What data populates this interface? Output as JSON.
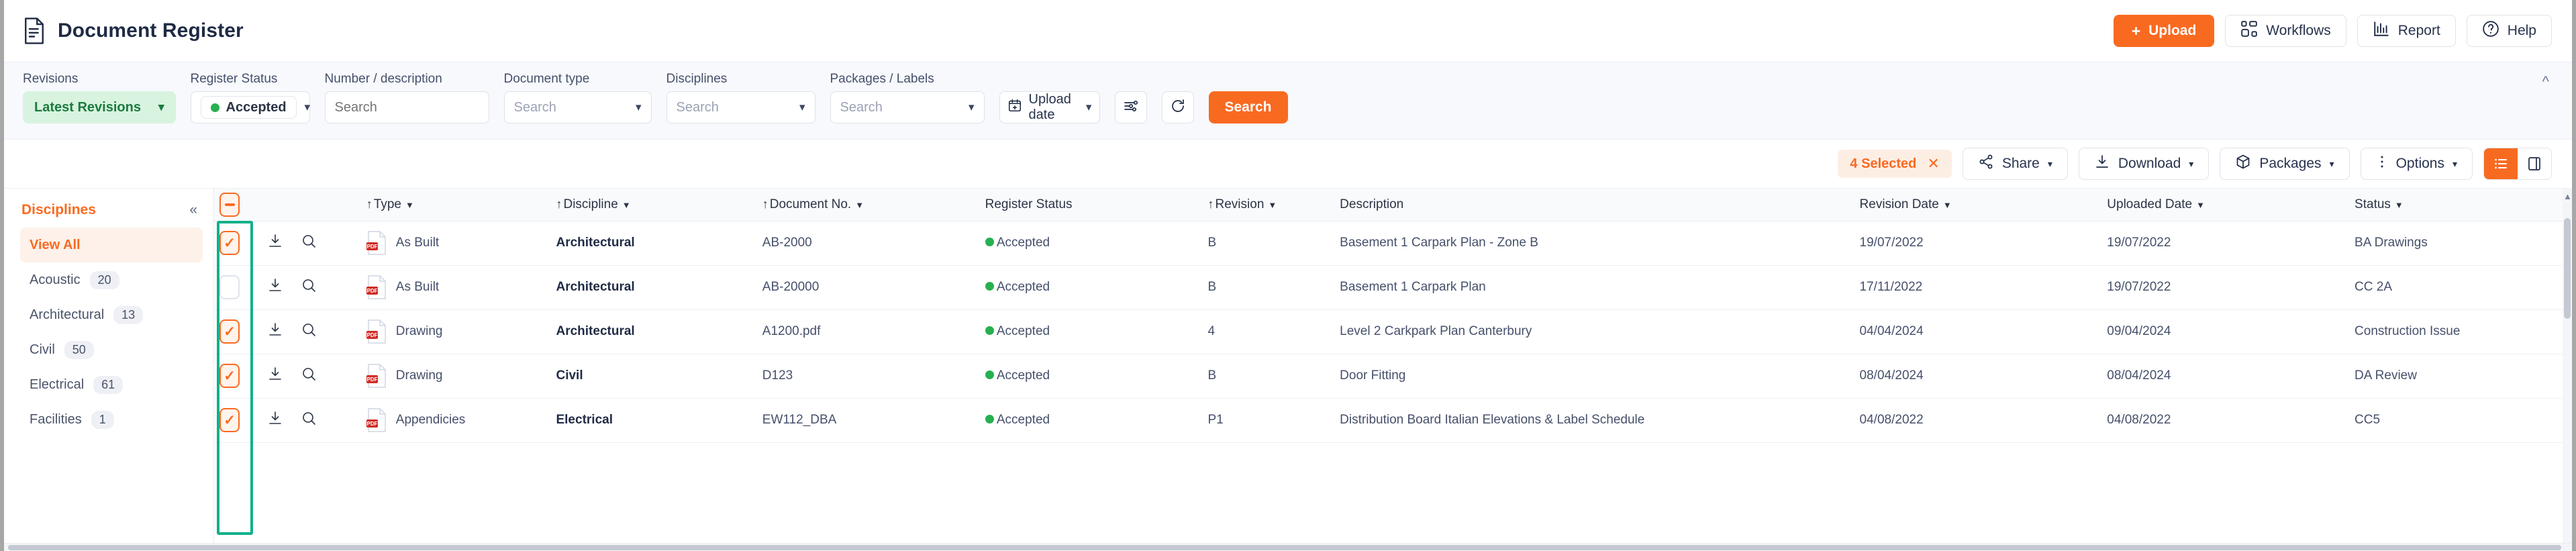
{
  "header": {
    "title": "Document Register",
    "doc_icon": "document-icon",
    "buttons": [
      {
        "label": "Upload",
        "icon": "plus-icon",
        "style": "primary"
      },
      {
        "label": "Workflows",
        "icon": "workflows-icon",
        "style": "default"
      },
      {
        "label": "Report",
        "icon": "bar-chart-icon",
        "style": "default"
      },
      {
        "label": "Help",
        "icon": "question-circle-icon",
        "style": "default"
      }
    ]
  },
  "filters": {
    "revisions": {
      "label": "Revisions",
      "value": "Latest Revisions"
    },
    "register_status": {
      "label": "Register Status",
      "value": "Accepted",
      "dot_color": "#27b050"
    },
    "number_description": {
      "label": "Number / description",
      "placeholder": "Search",
      "value": ""
    },
    "document_type": {
      "label": "Document type",
      "placeholder": "Search",
      "value": ""
    },
    "disciplines": {
      "label": "Disciplines",
      "placeholder": "Search",
      "value": ""
    },
    "packages_labels": {
      "label": "Packages / Labels",
      "placeholder": "Search",
      "value": ""
    },
    "upload_date": {
      "label": "Upload date",
      "icon": "calendar-plus-icon"
    },
    "settings_icon": "sliders-icon",
    "reset_icon": "refresh-icon",
    "search_button": "Search",
    "collapse_icon": "chevron-up-icon"
  },
  "toolbar": {
    "selected_text": "4 Selected",
    "clear_icon": "close-icon",
    "share": "Share",
    "download": "Download",
    "packages": "Packages",
    "options": "Options",
    "view_list_icon": "list-view-icon",
    "view_split_icon": "split-view-icon",
    "accent": "#f96a21"
  },
  "sidebar": {
    "title": "Disciplines",
    "collapse_icon": "chevron-double-left-icon",
    "items": [
      {
        "label": "View All",
        "count": "",
        "active": true
      },
      {
        "label": "Acoustic",
        "count": "20",
        "active": false
      },
      {
        "label": "Architectural",
        "count": "13",
        "active": false
      },
      {
        "label": "Civil",
        "count": "50",
        "active": false
      },
      {
        "label": "Electrical",
        "count": "61",
        "active": false
      },
      {
        "label": "Facilities",
        "count": "1",
        "active": false
      }
    ]
  },
  "table": {
    "header_checkbox_state": "indeterminate",
    "columns": [
      {
        "key": "type",
        "label": "Type",
        "sortable": true
      },
      {
        "key": "discipline",
        "label": "Discipline",
        "sortable": true
      },
      {
        "key": "document_no",
        "label": "Document No.",
        "sortable": true
      },
      {
        "key": "register_status",
        "label": "Register Status",
        "sortable": false
      },
      {
        "key": "revision",
        "label": "Revision",
        "sortable": true
      },
      {
        "key": "description",
        "label": "Description",
        "sortable": false
      },
      {
        "key": "revision_date",
        "label": "Revision Date",
        "sortable": true
      },
      {
        "key": "uploaded_date",
        "label": "Uploaded Date",
        "sortable": true
      },
      {
        "key": "status",
        "label": "Status",
        "sortable": true
      }
    ],
    "rows": [
      {
        "selected": true,
        "file_badge": "PDF",
        "type": "As Built",
        "discipline": "Architectural",
        "document_no": "AB-2000",
        "register_status": "Accepted",
        "revision": "B",
        "description": "Basement 1 Carpark Plan - Zone B",
        "revision_date": "19/07/2022",
        "uploaded_date": "19/07/2022",
        "status": "BA Drawings"
      },
      {
        "selected": false,
        "file_badge": "PDF",
        "type": "As Built",
        "discipline": "Architectural",
        "document_no": "AB-20000",
        "register_status": "Accepted",
        "revision": "B",
        "description": "Basement 1 Carpark Plan",
        "revision_date": "17/11/2022",
        "uploaded_date": "19/07/2022",
        "status": "CC 2A"
      },
      {
        "selected": true,
        "file_badge": "PDF",
        "type": "Drawing",
        "discipline": "Architectural",
        "document_no": "A1200.pdf",
        "register_status": "Accepted",
        "revision": "4",
        "description": "Level 2 Carkpark Plan Canterbury",
        "revision_date": "04/04/2024",
        "uploaded_date": "09/04/2024",
        "status": "Construction Issue"
      },
      {
        "selected": true,
        "file_badge": "PDF",
        "type": "Drawing",
        "discipline": "Civil",
        "document_no": "D123",
        "register_status": "Accepted",
        "revision": "B",
        "description": "Door Fitting",
        "revision_date": "08/04/2024",
        "uploaded_date": "08/04/2024",
        "status": "DA Review"
      },
      {
        "selected": true,
        "file_badge": "PDF",
        "type": "Appendicies",
        "discipline": "Electrical",
        "document_no": "EW112_DBA",
        "register_status": "Accepted",
        "revision": "P1",
        "description": "Distribution Board Italian Elevations & Label Schedule",
        "revision_date": "04/08/2022",
        "uploaded_date": "04/08/2022",
        "status": "CC5"
      }
    ],
    "row_icons": {
      "download": "download-icon",
      "preview": "magnifier-icon"
    }
  }
}
